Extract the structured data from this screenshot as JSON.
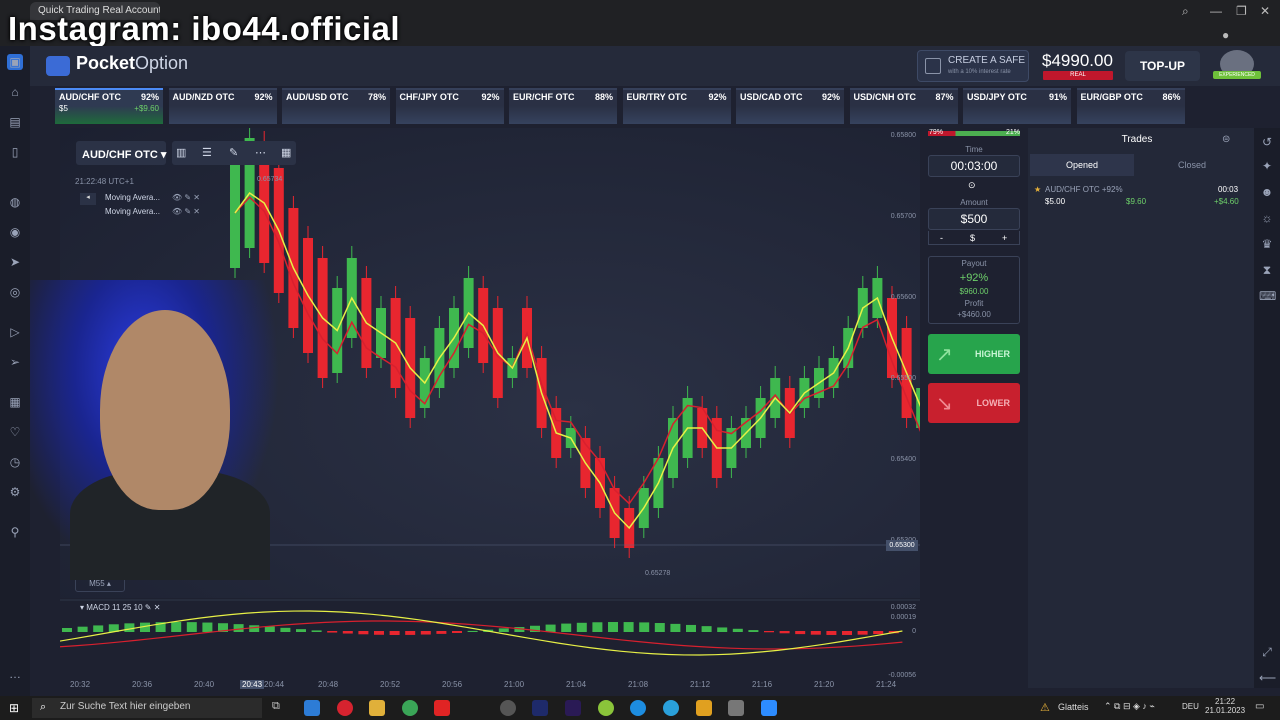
{
  "browser": {
    "tab_title": "Quick Trading Real Account",
    "watermark": "Instagram: ibo44.official"
  },
  "header": {
    "logo_text_bold": "Pocket",
    "logo_text_light": "Option",
    "safe_title": "CREATE A SAFE",
    "safe_subtitle": "with a 10% interest rate",
    "balance": "$4990.00",
    "balance_badge": "REAL",
    "topup_label": "TOP-UP",
    "avatar_badge": "EXPERIENCED"
  },
  "assets": [
    {
      "name": "AUD/CHF OTC",
      "payout": "92%",
      "stake": "$5",
      "profit": "+$9.60",
      "active": true
    },
    {
      "name": "AUD/NZD OTC",
      "payout": "92%"
    },
    {
      "name": "AUD/USD OTC",
      "payout": "78%"
    },
    {
      "name": "CHF/JPY OTC",
      "payout": "92%"
    },
    {
      "name": "EUR/CHF OTC",
      "payout": "88%"
    },
    {
      "name": "EUR/TRY OTC",
      "payout": "92%"
    },
    {
      "name": "USD/CAD OTC",
      "payout": "92%"
    },
    {
      "name": "USD/CNH OTC",
      "payout": "87%"
    },
    {
      "name": "USD/JPY OTC",
      "payout": "91%"
    },
    {
      "name": "EUR/GBP OTC",
      "payout": "86%"
    }
  ],
  "chart": {
    "pair": "AUD/CHF OTC",
    "time": "21:22:48 UTC+1",
    "indicators": [
      "Moving Avera...",
      "Moving Avera..."
    ],
    "timeframe": "M55",
    "macd_label": "MACD 11 25 10",
    "high_label": "0.65734",
    "low_label": "0.65278",
    "current_price": "0.65300",
    "price_ticks": [
      "0.65800",
      "0.65700",
      "0.65600",
      "0.65500",
      "0.65400",
      "0.65300"
    ],
    "macd_ticks": [
      "0.00032",
      "0.00019",
      "0",
      "-0.00056"
    ],
    "time_ticks": [
      "20:32",
      "20:36",
      "20:40",
      "20:43",
      "20:44",
      "20:48",
      "20:52",
      "20:56",
      "21:00",
      "21:04",
      "21:08",
      "21:12",
      "21:16",
      "21:20",
      "21:24"
    ]
  },
  "trade": {
    "payout_left": "79%",
    "payout_right": "21%",
    "time_label": "Time",
    "time_value": "00:03:00",
    "amount_label": "Amount",
    "amount_value": "$500",
    "minus": "-",
    "currency": "$",
    "plus": "+",
    "payout_label": "Payout",
    "payout_pct": "+92%",
    "payout_amount": "$960.00",
    "profit_label": "Profit",
    "profit_amount": "+$460.00",
    "higher_label": "HIGHER",
    "lower_label": "LOWER"
  },
  "trades_panel": {
    "title": "Trades",
    "tab_opened": "Opened",
    "tab_closed": "Closed",
    "item_asset": "AUD/CHF OTC +92%",
    "item_time": "00:03",
    "item_stake": "$5.00",
    "item_payout": "$9.60",
    "item_profit": "+$4.60"
  },
  "taskbar": {
    "search_placeholder": "Zur Suche Text hier eingeben",
    "weather": "Glatteis",
    "lang": "DEU",
    "time": "21:22",
    "date": "21.01.2023"
  },
  "colors": {
    "bull": "#3fb84f",
    "bear": "#e8262f",
    "ma_fast": "#e7f046",
    "ma_slow": "#d8202e",
    "higher": "#27a44c",
    "lower": "#c8202e"
  }
}
